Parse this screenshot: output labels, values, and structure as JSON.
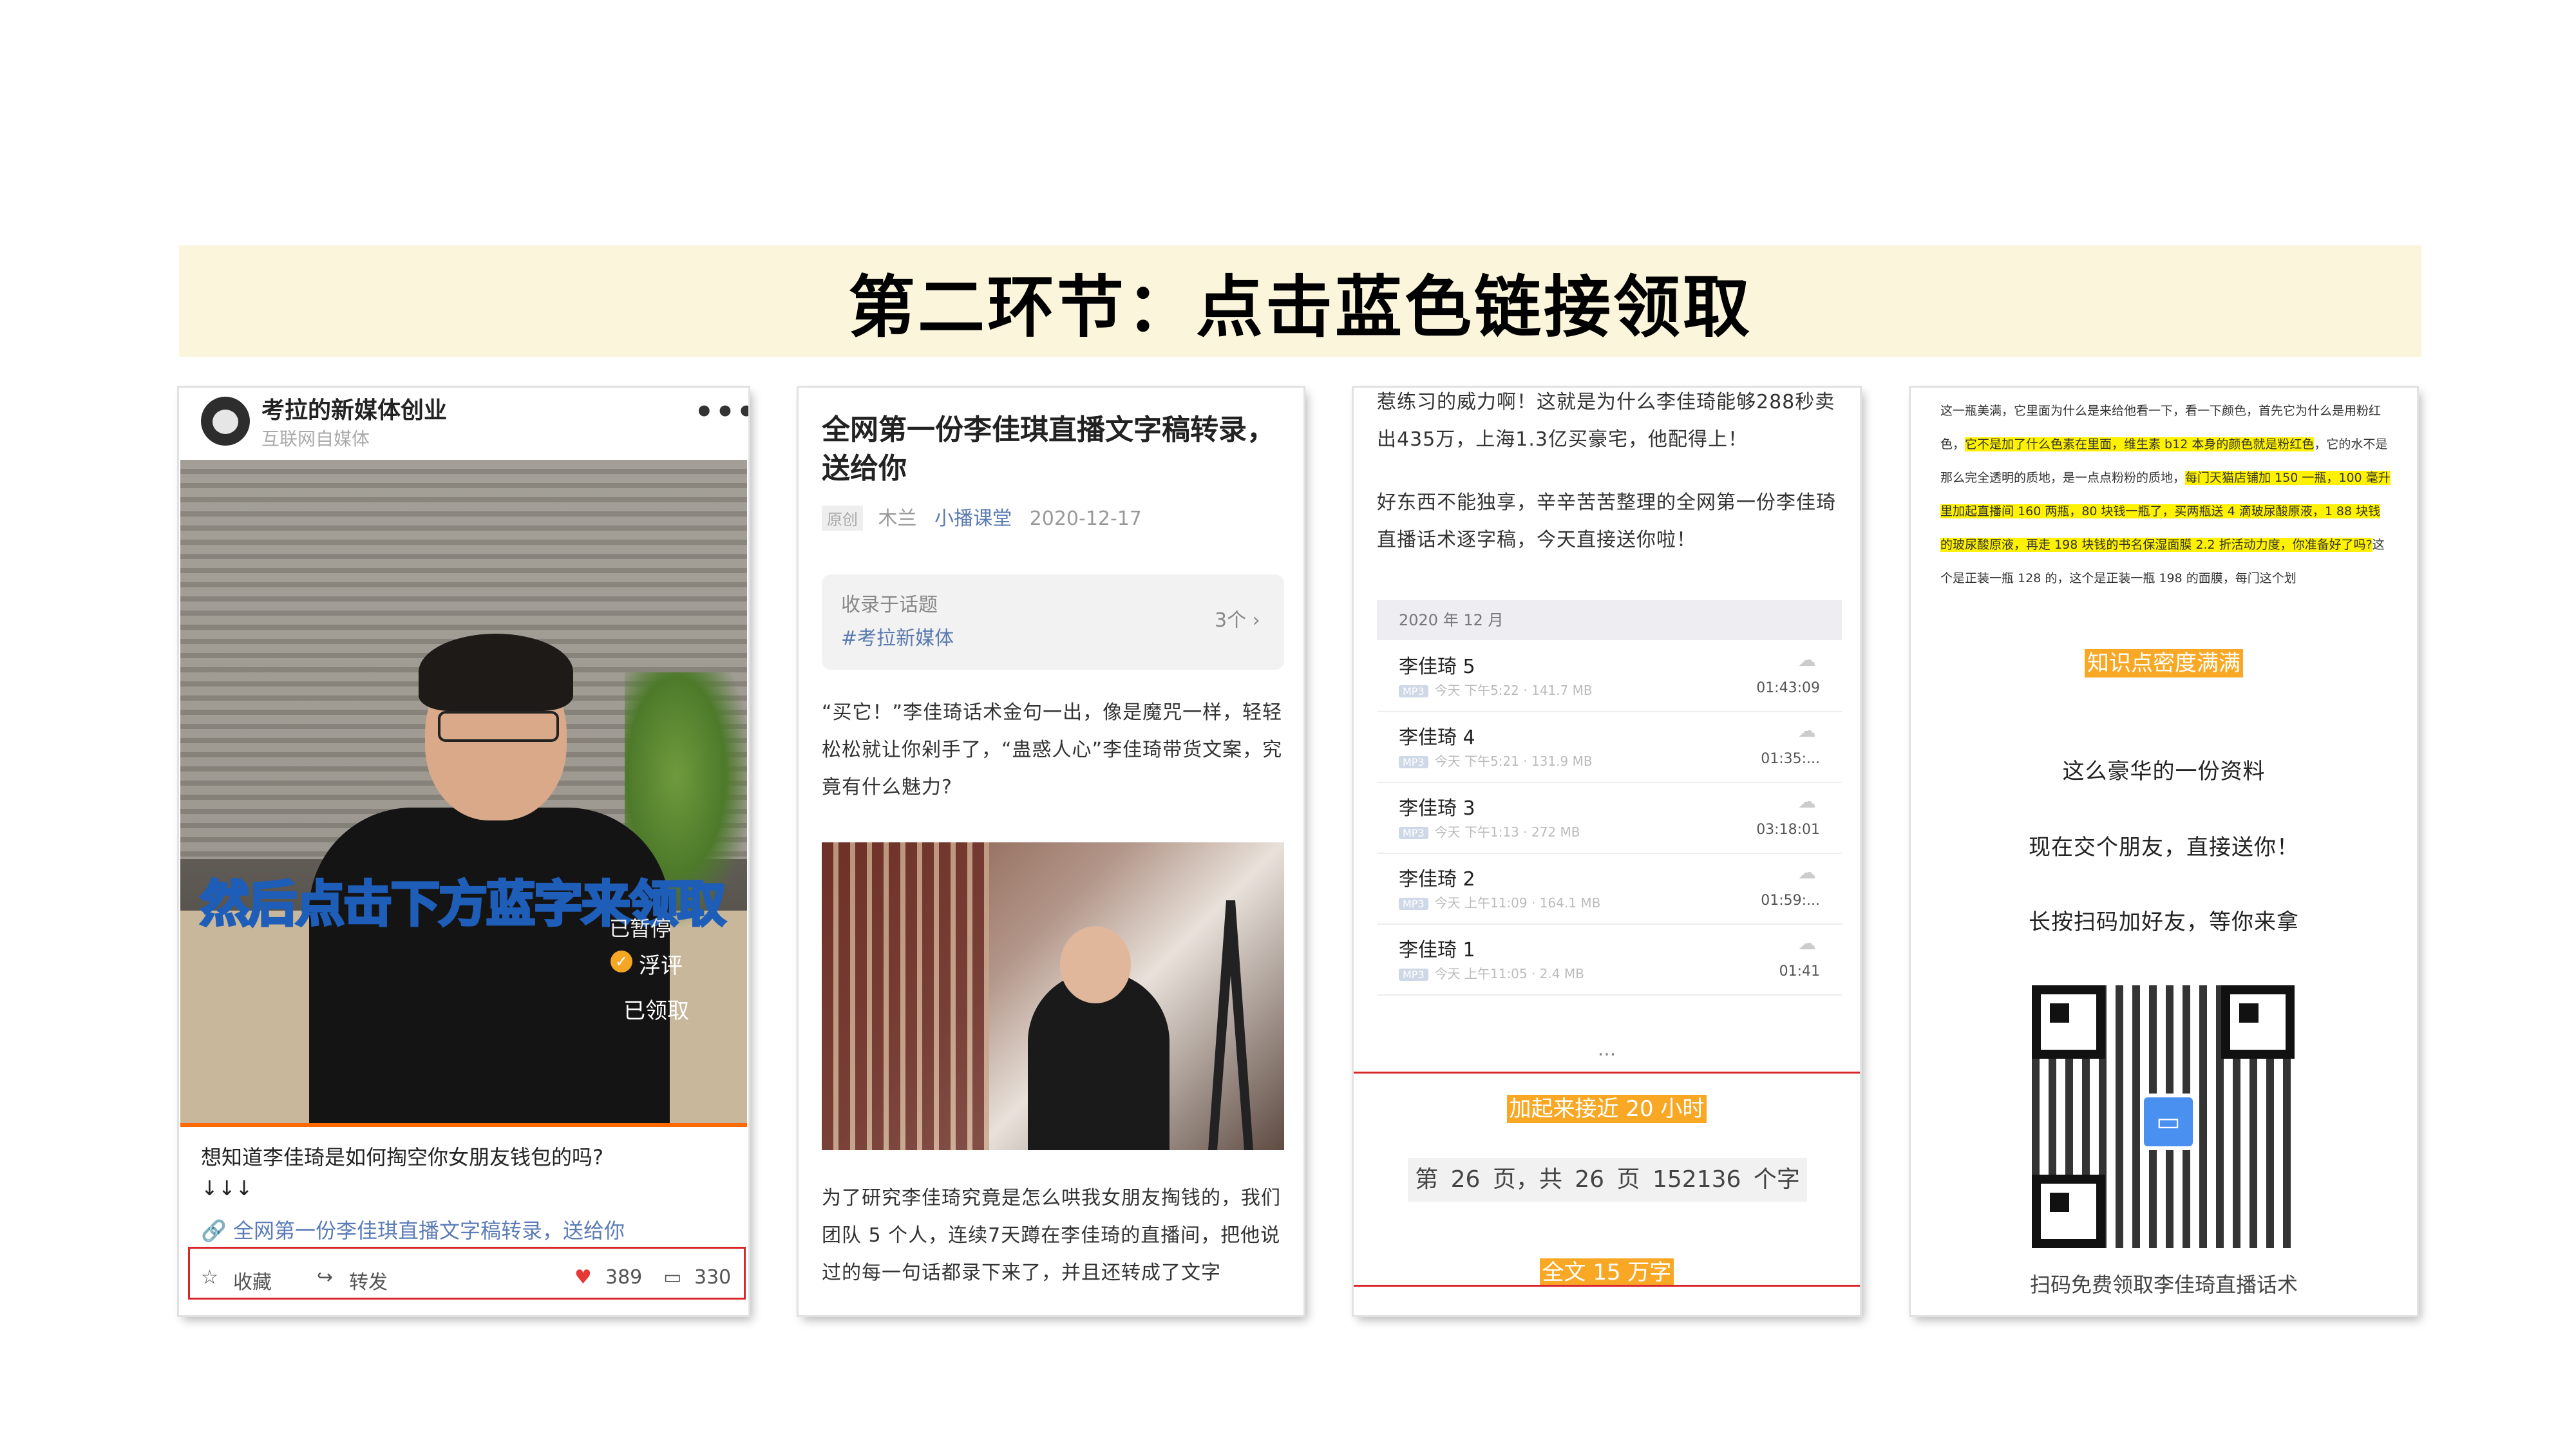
{
  "banner": {
    "title": "第二环节：点击蓝色链接领取"
  },
  "card1": {
    "account_name": "考拉的新媒体创业",
    "account_sub": "互联网自媒体",
    "more": "•••",
    "video_caption": "然后点击下方蓝字来领取",
    "paused": "已暂停",
    "fuping": "浮评",
    "claimed": "已领取",
    "desc": "想知道李佳琦是如何掏空你女朋友钱包的吗?",
    "arrows": "↓↓↓",
    "link": "全网第一份李佳琪直播文字稿转录，送给你",
    "collect": "收藏",
    "share": "转发",
    "likes": "389",
    "comments": "330"
  },
  "card2": {
    "title": "全网第一份李佳琪直播文字稿转录，送给你",
    "tag": "原创",
    "author": "木兰",
    "channel": "小播课堂",
    "date": "2020-12-17",
    "topic_label": "收录于话题",
    "topic_link": "#考拉新媒体",
    "topic_count": "3个 ›",
    "intro": "“买它！”李佳琦话术金句一出，像是魔咒一样，轻轻松松就让你剁手了，“蛊惑人心”李佳琦带货文案，究竟有什么魅力?",
    "body": "为了研究李佳琦究竟是怎么哄我女朋友掏钱的，我们团队 5 个人，连续7天蹲在李佳琦的直播间，把他说过的每一句话都录下来了，并且还转成了文字"
  },
  "card3": {
    "top_text": "惹练习的威力啊！这就是为什么李佳琦能够288秒卖出435万，上海1.3亿买豪宅，他配得上！",
    "para2": "好东西不能独享，辛辛苦苦整理的全网第一份李佳琦直播话术逐字稿，今天直接送你啦！",
    "month": "2020 年 12 月",
    "files": [
      {
        "name": "李佳琦 5",
        "meta": "今天 下午5:22 · 141.7 MB",
        "duration": "01:43:09"
      },
      {
        "name": "李佳琦 4",
        "meta": "今天 下午5:21 · 131.9 MB",
        "duration": "01:35:..."
      },
      {
        "name": "李佳琦 3",
        "meta": "今天 下午1:13 · 272 MB",
        "duration": "03:18:01"
      },
      {
        "name": "李佳琦 2",
        "meta": "今天 上午11:09 · 164.1 MB",
        "duration": "01:59:..."
      },
      {
        "name": "李佳琦 1",
        "meta": "今天 上午11:05 · 2.4 MB",
        "duration": "01:41"
      }
    ],
    "mp3_tag": "MP3",
    "ellipsis": "...",
    "highlight1": "加起来接近 20 小时",
    "pages": "第 26 页，共 26 页    152136 个字",
    "highlight2": "全文 15 万字"
  },
  "card4": {
    "text_a": "这一瓶美满，它里面为什么是来给他看一下，看一下颜色，首先它为什么是用粉红色，",
    "text_b": "它不是加了什么色素在里面，维生素 b12 本身的颜色就是粉红色",
    "text_c": "，它的水不是那么完全透明的质地，是一点点粉粉的质地，",
    "text_d": "每门天猫店铺加 150 一瓶，100 毫升里加起直播间 160 两瓶，80 块钱一瓶了，买两瓶送 4 滴玻尿酸原液，1 88 块钱的玻尿酸原液，再走 198 块钱的书名保湿面膜 2.2 折活动力度，你准备好了吗?",
    "text_e": "这个是正装一瓶 128 的，这个是正装一瓶 198 的面膜，每门这个划",
    "highlight": "知识点密度满满",
    "line1": "这么豪华的一份资料",
    "line2": "现在交个朋友，直接送你！",
    "line3": "长按扫码加好友，等你来拿",
    "footer": "扫码免费领取李佳琦直播话术"
  }
}
